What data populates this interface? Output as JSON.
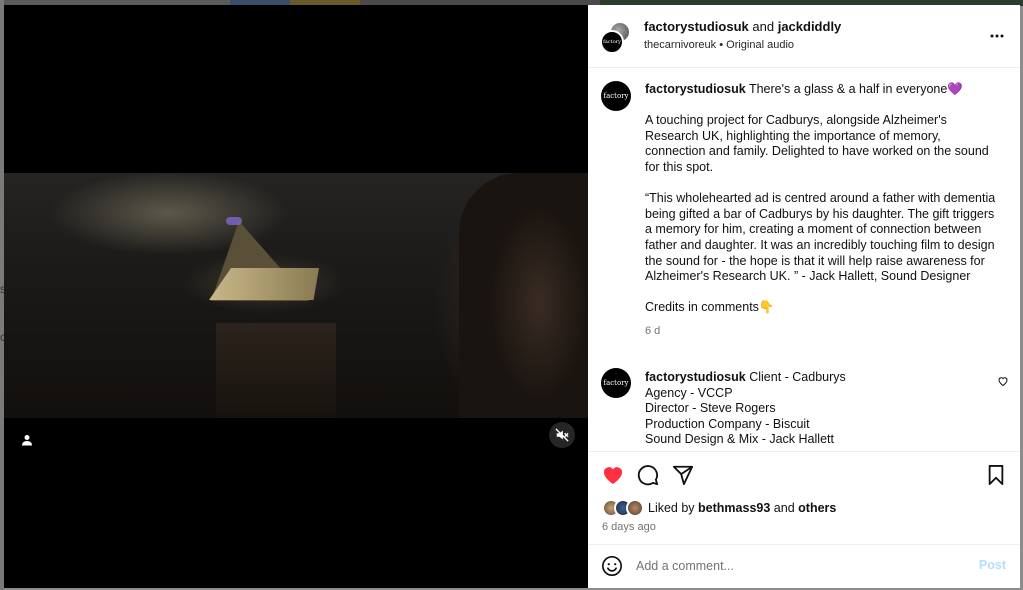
{
  "header": {
    "user1": "factorystudiosuk",
    "connector": "and",
    "user2": "jackdiddly",
    "audio_user": "thecarnivoreuk",
    "separator": "•",
    "audio_label": "Original audio",
    "avatar_text": "factory",
    "more_icon": "more-horizontal-icon"
  },
  "caption": {
    "avatar_text": "factory",
    "username": "factorystudiosuk",
    "first_line": "There's a glass & a half in everyone💜",
    "para1": "A touching project for Cadburys, alongside Alzheimer's Research UK, highlighting the importance of memory, connection and family. Delighted to have worked on the sound for this spot.",
    "para2": "“This wholehearted ad is centred around a father with dementia being gifted a bar of Cadburys by his daughter. The gift triggers a memory for him, creating a moment of connection between father and daughter. It was an incredibly touching film to design the sound for - the hope is that it will help raise awareness for Alzheimer's Research UK. ” - Jack Hallett, Sound Designer",
    "para3": "Credits in comments👇",
    "time": "6 d"
  },
  "comment": {
    "avatar_text": "factory",
    "username": "factorystudiosuk",
    "line1": "Client - Cadburys",
    "line2": "Agency - VCCP",
    "line3": "Director - Steve Rogers",
    "line4": "Production Company - Biscuit",
    "line5": "Sound Design & Mix - Jack Hallett"
  },
  "actions": {
    "liked_prefix": "Liked by",
    "liked_user": "bethmass93",
    "liked_and": "and",
    "liked_others": "others",
    "posted": "6 days ago",
    "like_color": "#ff3040"
  },
  "add_comment": {
    "placeholder": "Add a comment...",
    "post_label": "Post"
  },
  "edge_letters": [
    "s",
    "c"
  ]
}
